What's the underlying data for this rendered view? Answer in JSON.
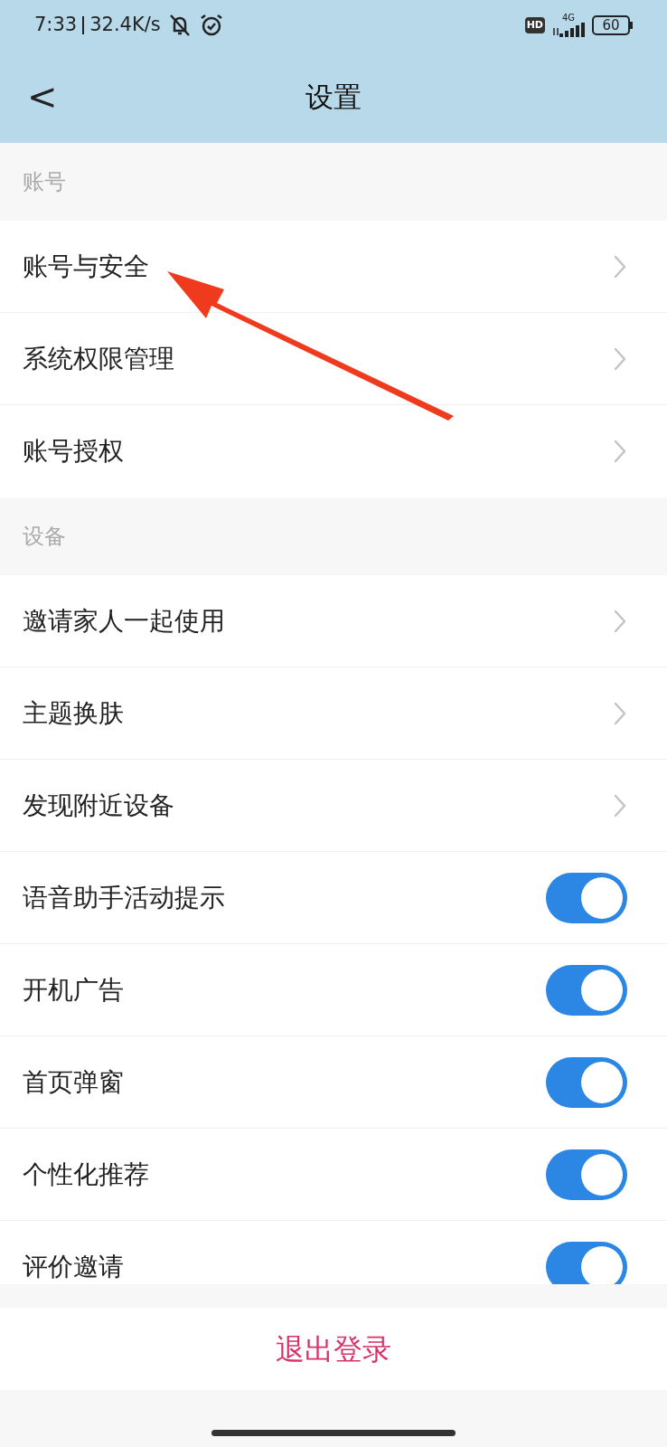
{
  "status_bar": {
    "time": "7:33",
    "speed": "32.4K/s",
    "hd": "HD",
    "network": "4G",
    "battery": "60"
  },
  "header": {
    "back": "<",
    "title": "设置"
  },
  "sections": [
    {
      "title": "账号",
      "items": [
        {
          "kind": "link",
          "label": "账号与安全"
        },
        {
          "kind": "link",
          "label": "系统权限管理"
        },
        {
          "kind": "link",
          "label": "账号授权"
        }
      ]
    },
    {
      "title": "设备",
      "items": [
        {
          "kind": "link",
          "label": "邀请家人一起使用"
        },
        {
          "kind": "link",
          "label": "主题换肤"
        },
        {
          "kind": "link",
          "label": "发现附近设备"
        },
        {
          "kind": "toggle",
          "label": "语音助手活动提示",
          "on": true
        },
        {
          "kind": "toggle",
          "label": "开机广告",
          "on": true
        },
        {
          "kind": "toggle",
          "label": "首页弹窗",
          "on": true
        },
        {
          "kind": "toggle",
          "label": "个性化推荐",
          "on": true
        },
        {
          "kind": "toggle",
          "label": "评价邀请",
          "on": true
        }
      ]
    }
  ],
  "logout": "退出登录"
}
